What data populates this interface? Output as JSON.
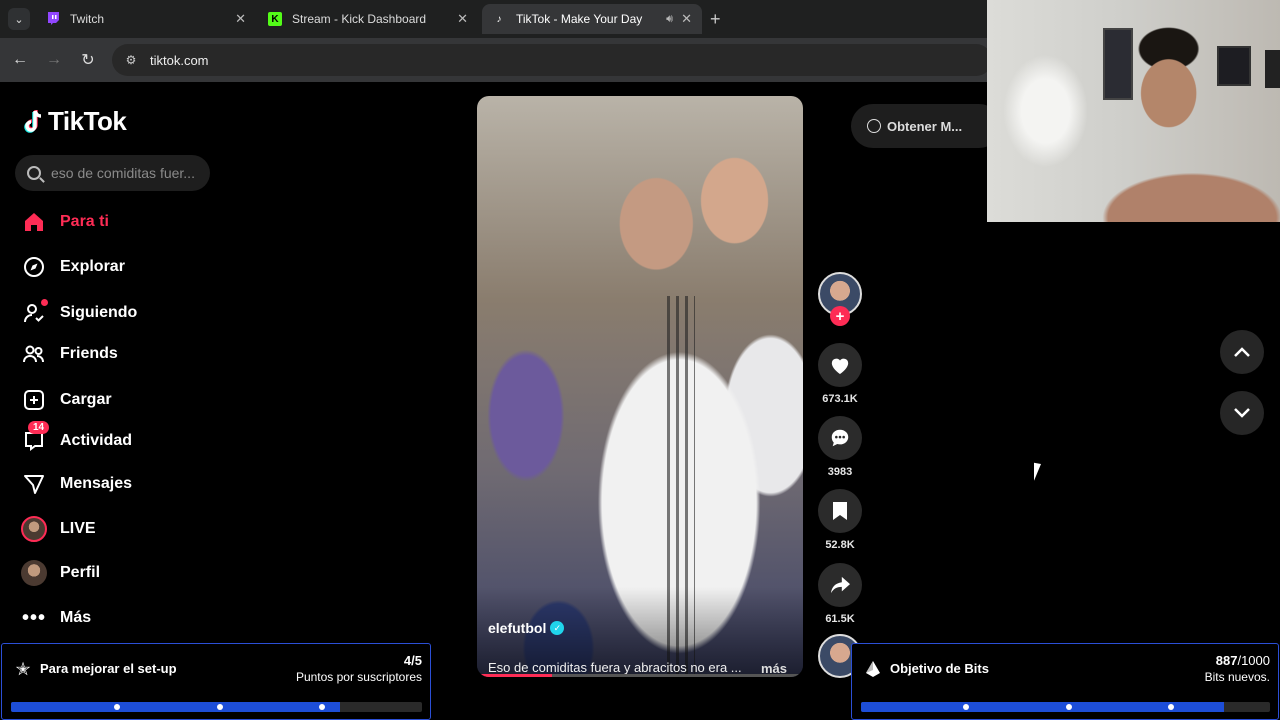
{
  "browser": {
    "tabs": [
      {
        "title": "Twitch",
        "icon": "twitch-icon",
        "color": "#9146ff"
      },
      {
        "title": "Stream - Kick Dashboard",
        "icon": "kick-icon",
        "color": "#53fc18"
      },
      {
        "title": "TikTok - Make Your Day",
        "icon": "tiktok-icon",
        "color": "#ffffff"
      }
    ],
    "new_tab": "+",
    "url": "tiktok.com"
  },
  "tiktok": {
    "logo": "TikTok",
    "search_placeholder": "eso de comiditas fuer...",
    "nav": [
      {
        "label": "Para ti",
        "icon": "home-icon",
        "active": true
      },
      {
        "label": "Explorar",
        "icon": "compass-icon"
      },
      {
        "label": "Siguiendo",
        "icon": "following-icon"
      },
      {
        "label": "Friends",
        "icon": "friends-icon"
      },
      {
        "label": "Cargar",
        "icon": "upload-icon"
      },
      {
        "label": "Actividad",
        "icon": "activity-icon",
        "badge": "14"
      },
      {
        "label": "Mensajes",
        "icon": "messages-icon"
      },
      {
        "label": "LIVE",
        "icon": "live-icon"
      },
      {
        "label": "Perfil",
        "icon": "profile-icon"
      },
      {
        "label": "Más",
        "icon": "more-icon"
      }
    ],
    "get_app": "Obtener M...",
    "video": {
      "author": "elefutbol",
      "caption": "Eso de comiditas fuera y abracitos no era ...",
      "more": "más",
      "progress": 0.23
    },
    "actions": {
      "likes": "673.1K",
      "comments": "3983",
      "saves": "52.8K",
      "shares": "61.5K"
    },
    "accent": "#fe2c55"
  },
  "overlays": {
    "goal_left": {
      "title": "Para mejorar el set-up",
      "value": "4/5",
      "sub": "Puntos por suscriptores",
      "fraction": 0.8
    },
    "goal_right": {
      "title": "Objetivo de Bits",
      "value_current": "887",
      "value_total": "/1000",
      "sub": "Bits nuevos.",
      "fraction": 0.887
    }
  }
}
